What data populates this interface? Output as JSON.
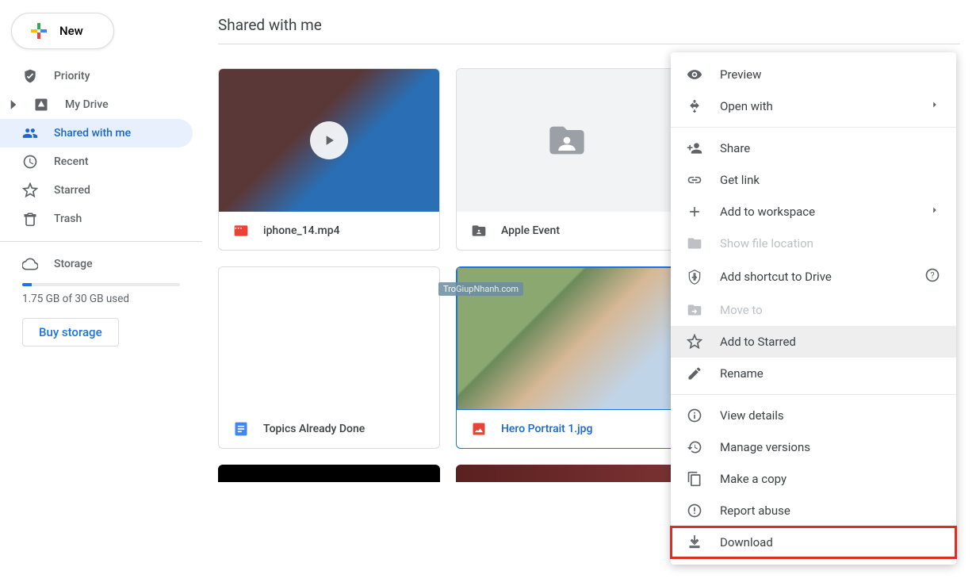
{
  "sidebar": {
    "new_label": "New",
    "items": [
      {
        "label": "Priority",
        "icon": "priority"
      },
      {
        "label": "My Drive",
        "icon": "mydrive",
        "expandable": true
      },
      {
        "label": "Shared with me",
        "icon": "shared",
        "active": true
      },
      {
        "label": "Recent",
        "icon": "recent"
      },
      {
        "label": "Starred",
        "icon": "starred"
      },
      {
        "label": "Trash",
        "icon": "trash"
      }
    ],
    "storage_label": "Storage",
    "storage_text": "1.75 GB of 30 GB used",
    "buy_label": "Buy storage"
  },
  "page": {
    "title": "Shared with me",
    "watermark": "TroGiupNhanh.com"
  },
  "files": [
    {
      "name": "iphone_14.mp4",
      "type": "video"
    },
    {
      "name": "Apple Event",
      "type": "folder"
    },
    {
      "name": "Topics Already Done",
      "type": "doc"
    },
    {
      "name": "Hero Portrait 1.jpg",
      "type": "image",
      "selected": true
    }
  ],
  "menu": {
    "preview": "Preview",
    "open_with": "Open with",
    "share": "Share",
    "get_link": "Get link",
    "add_workspace": "Add to workspace",
    "show_location": "Show file location",
    "add_shortcut": "Add shortcut to Drive",
    "move_to": "Move to",
    "add_starred": "Add to Starred",
    "rename": "Rename",
    "view_details": "View details",
    "manage_versions": "Manage versions",
    "make_copy": "Make a copy",
    "report_abuse": "Report abuse",
    "download": "Download"
  }
}
